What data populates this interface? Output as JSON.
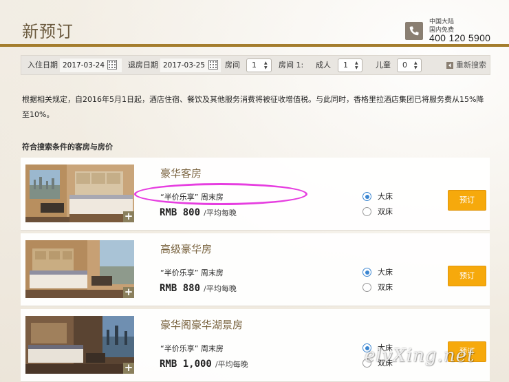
{
  "header": {
    "title": "新预订",
    "phone": {
      "region": "中国大陆",
      "note": "国内免费",
      "number": "400 120 5900"
    }
  },
  "search": {
    "checkin_label": "入住日期",
    "checkin_value": "2017-03-24",
    "checkout_label": "退房日期",
    "checkout_value": "2017-03-25",
    "rooms_label": "房间",
    "rooms_value": "1",
    "room_index_label": "房间 1:",
    "adults_label": "成人",
    "adults_value": "1",
    "children_label": "儿童",
    "children_value": "0",
    "reset_label": "重新搜索"
  },
  "notice": "根据相关规定，自2016年5月1日起，酒店住宿、餐饮及其他服务消费将被征收增值税。与此同时，香格里拉酒店集团已将服务费从15%降至10%。",
  "results_heading": "符合搜索条件的客房与房价",
  "rooms": [
    {
      "name": "豪华客房",
      "offer": "“半价乐享” 周末房",
      "price": "RMB 800",
      "unit": "/平均每晚",
      "bed_options": [
        "大床",
        "双床"
      ],
      "selected_bed": "大床",
      "book_label": "预订"
    },
    {
      "name": "高级豪华房",
      "offer": "“半价乐享” 周末房",
      "price": "RMB 880",
      "unit": "/平均每晚",
      "bed_options": [
        "大床",
        "双床"
      ],
      "selected_bed": "大床",
      "book_label": "预订"
    },
    {
      "name": "豪华阁豪华湖景房",
      "offer": "“半价乐享” 周末房",
      "price": "RMB 1,000",
      "unit": "/平均每晚",
      "bed_options": [
        "大床",
        "双床"
      ],
      "selected_bed": "大床",
      "book_label": "预订"
    }
  ],
  "watermark": "elvXing.net",
  "colors": {
    "gold": "#a47d2d",
    "book_button": "#f6a90c",
    "radio_selected": "#3b86d1",
    "highlight": "#e63ee0"
  }
}
